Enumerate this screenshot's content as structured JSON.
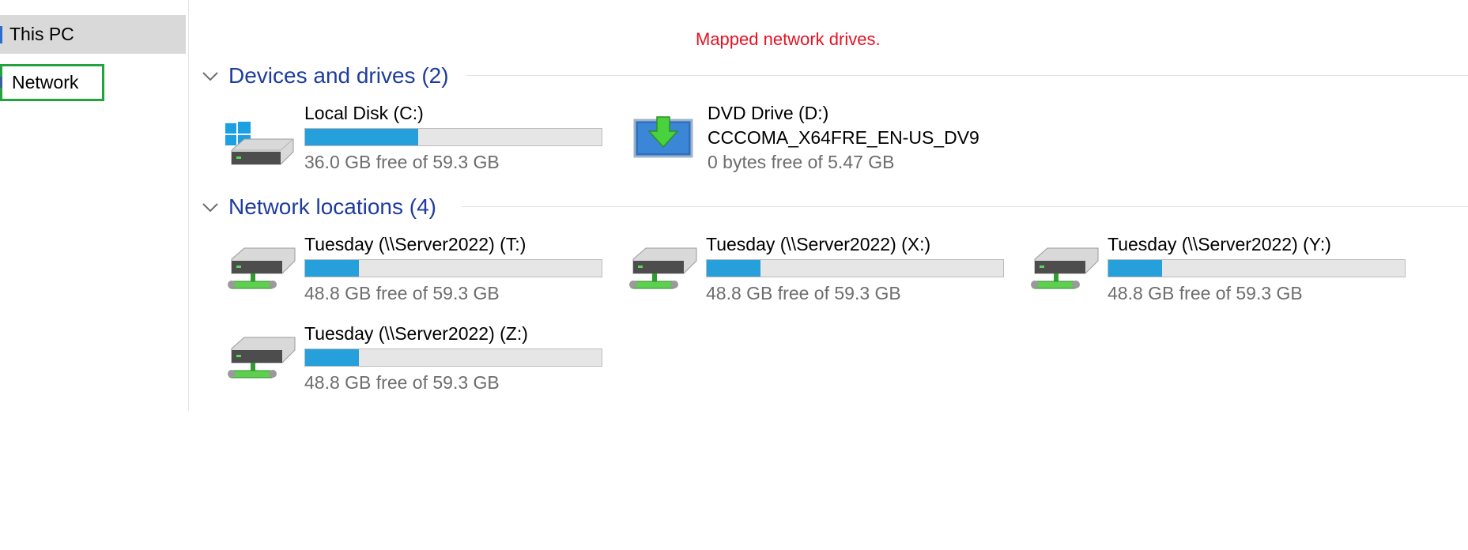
{
  "sidebar": {
    "items": [
      {
        "label": "This PC"
      },
      {
        "label": "Network"
      }
    ]
  },
  "annotation": "Mapped network drives.",
  "groups": {
    "devices": {
      "title": "Devices and drives (2)"
    },
    "network": {
      "title": "Network locations (4)"
    }
  },
  "drives": [
    {
      "name": "Local Disk (C:)",
      "free": "36.0 GB free of 59.3 GB",
      "used_fraction": 0.38
    },
    {
      "name": "DVD Drive (D:)",
      "volume_label": "CCCOMA_X64FRE_EN-US_DV9",
      "free": "0 bytes free of 5.47 GB"
    }
  ],
  "network_drives": [
    {
      "name": "Tuesday (\\\\Server2022) (T:)",
      "free": "48.8 GB free of 59.3 GB",
      "used_fraction": 0.18
    },
    {
      "name": "Tuesday (\\\\Server2022) (X:)",
      "free": "48.8 GB free of 59.3 GB",
      "used_fraction": 0.18
    },
    {
      "name": "Tuesday (\\\\Server2022) (Y:)",
      "free": "48.8 GB free of 59.3 GB",
      "used_fraction": 0.18
    },
    {
      "name": "Tuesday (\\\\Server2022) (Z:)",
      "free": "48.8 GB free of 59.3 GB",
      "used_fraction": 0.18
    }
  ],
  "colors": {
    "bar_fill": "#26a0da",
    "group_title": "#1e3c9e",
    "annotation": "#e81123",
    "highlight_border": "#22a33d"
  },
  "icons": {
    "local_disk": "windows-drive-icon",
    "dvd": "dvd-drive-icon",
    "network_drive": "network-drive-icon"
  }
}
